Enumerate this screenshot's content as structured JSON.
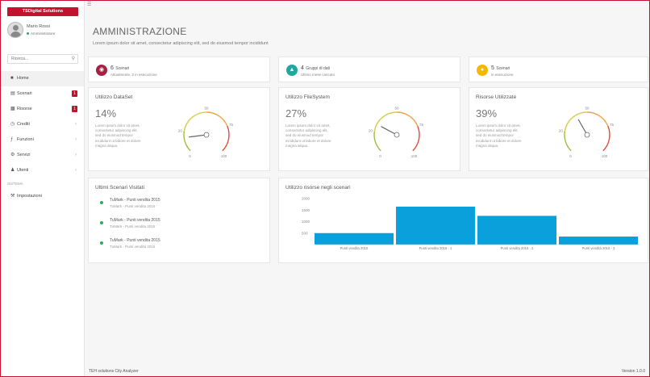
{
  "colors": {
    "brand": "#c6102e",
    "accent_blue": "#0aa0dc",
    "purple_red": "#a32242",
    "teal": "#1fa7a0",
    "yellow": "#f5b800",
    "online": "#27ae60"
  },
  "sidebar": {
    "brand": "TSDigital Solutions",
    "user": {
      "name": "Mario Rossi",
      "status": "Amministratore"
    },
    "search": {
      "placeholder": "Ricerca...",
      "icon": "search-icon"
    },
    "items": [
      {
        "label": "Home",
        "icon": "home-icon"
      },
      {
        "label": "Scenari",
        "icon": "list-icon",
        "badge": "1"
      },
      {
        "label": "Risorse",
        "icon": "database-icon",
        "badge": "1"
      },
      {
        "label": "Crediti",
        "icon": "clock-icon",
        "chevron": "›"
      },
      {
        "label": "Funzioni",
        "icon": "function-icon",
        "chevron": "›"
      },
      {
        "label": "Servizi",
        "icon": "gear-icon",
        "chevron": "›"
      },
      {
        "label": "Utenti",
        "icon": "users-icon",
        "chevron": "›"
      }
    ],
    "section_label": "SISTEMA",
    "settings_item": {
      "label": "Impostazioni",
      "icon": "wrench-icon"
    }
  },
  "main": {
    "title": "AMMINISTRAZIONE",
    "subtitle": "Lorem ipsum dolor sit amet, consectetur adipiscing elit, sed do eiusmod tempor incididunt",
    "stats": [
      {
        "number": "6",
        "label": "Scenari",
        "sub": "Attualmente, 2 in esecuzione",
        "icon": "scenario-icon"
      },
      {
        "number": "4",
        "label": "Gruppi di dati",
        "sub": "Ultimo mese caricato",
        "icon": "data-icon"
      },
      {
        "number": "5",
        "label": "Scenari",
        "sub": "in esecuzione",
        "icon": "scenario-run-icon"
      }
    ],
    "gauges": [
      {
        "title": "Utilizzo DataSet",
        "percent": "14%",
        "value_fraction": 0.14,
        "desc": "Lorem ipsum dolor sit amet, consectetur adipiscing elit, sed do eiusmod tempor incididunt ut labore et dolore magna aliqua.",
        "min": "0",
        "max": "100",
        "ticks": [
          "20",
          "50",
          "75"
        ]
      },
      {
        "title": "Utilizzo FileSystem",
        "percent": "27%",
        "value_fraction": 0.27,
        "desc": "Lorem ipsum dolor sit amet, consectetur adipiscing elit, sed do eiusmod tempor incididunt ut labore et dolore magna aliqua.",
        "min": "0",
        "max": "100",
        "ticks": [
          "20",
          "50",
          "75"
        ]
      },
      {
        "title": "Risorse Utilizzate",
        "percent": "39%",
        "value_fraction": 0.39,
        "desc": "Lorem ipsum dolor sit amet, consectetur adipiscing elit, sed do eiusmod tempor incididunt ut labore et dolore magna aliqua.",
        "min": "0",
        "max": "100",
        "ticks": [
          "20",
          "50",
          "75"
        ]
      }
    ],
    "visits": {
      "title": "Ultimi Scenari Visitati",
      "items": [
        {
          "title": "TuMark - Punti vendita 2015",
          "sub": "TuMark - Punti vendita 2015"
        },
        {
          "title": "TuMark - Punti vendita 2015",
          "sub": "TuMark - Punti vendita 2015"
        },
        {
          "title": "TuMark - Punti vendita 2015",
          "sub": "TuMark - Punti vendita 2015"
        }
      ]
    },
    "chart_title": "Utilizzo risorse negli scenari"
  },
  "chart_data": {
    "type": "bar",
    "title": "Utilizzo risorse negli scenari",
    "categories": [
      "Punti vendita 2015",
      "Punti vendita 2016 - 1",
      "Punti vendita 2016 - 2",
      "Punti vendita 2016 - 3"
    ],
    "values": [
      500,
      1650,
      1250,
      350
    ],
    "y_ticks": [
      "2000",
      "1500",
      "1000",
      "500"
    ],
    "ylim": [
      0,
      2000
    ],
    "xlabel": "",
    "ylabel": "",
    "grid": false,
    "color": "#0aa0dc"
  },
  "footer": {
    "left": "TEH solutions City Analyzer",
    "right": "Version 1.0.0"
  }
}
